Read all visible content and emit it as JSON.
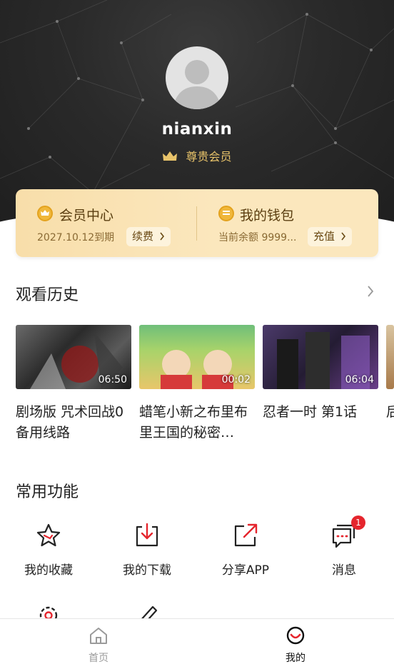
{
  "profile": {
    "username": "nianxin",
    "vip_label": "尊贵会员"
  },
  "member_card": {
    "vip_center": {
      "title": "会员中心",
      "expiry": "2027.10.12到期",
      "action": "续费"
    },
    "wallet": {
      "title": "我的钱包",
      "balance": "当前余额 9999...",
      "action": "充值"
    }
  },
  "history": {
    "title": "观看历史",
    "items": [
      {
        "title": "剧场版 咒术回战0 备用线路",
        "duration": "06:50"
      },
      {
        "title": "蜡笔小新之布里布里王国的秘密…",
        "duration": "00:02"
      },
      {
        "title": "忍者一时 第1话",
        "duration": "06:04"
      },
      {
        "title": "后",
        "duration": ""
      }
    ]
  },
  "functions": {
    "title": "常用功能",
    "items": [
      {
        "label": "我的收藏",
        "icon": "star-icon"
      },
      {
        "label": "我的下载",
        "icon": "download-icon"
      },
      {
        "label": "分享APP",
        "icon": "share-icon"
      },
      {
        "label": "消息",
        "icon": "message-icon",
        "badge": "1"
      },
      {
        "label": "",
        "icon": "settings-icon"
      },
      {
        "label": "",
        "icon": "edit-icon"
      }
    ]
  },
  "tabbar": {
    "home": "首页",
    "mine": "我的"
  },
  "colors": {
    "accent": "#e5252d",
    "gold": "#e8c36a",
    "hero_bg": "#2a2a2a"
  }
}
